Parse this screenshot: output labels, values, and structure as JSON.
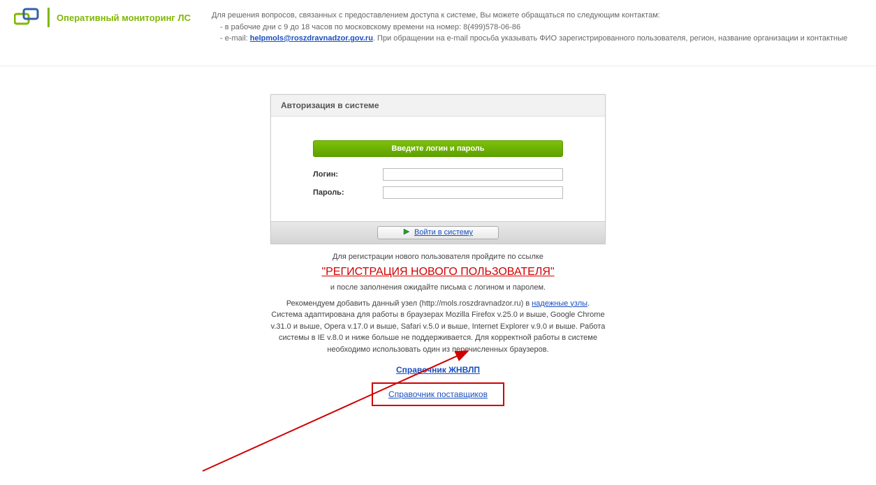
{
  "header": {
    "app_title": "Оперативный мониторинг ЛС",
    "contact_intro": "Для решения вопросов, связанных с предоставлением доступа к системе, Вы можете обращаться по следующим контактам:",
    "contact_phone": "- в рабочие дни с 9 до 18 часов по московскому времени на номер: 8(499)578-06-86",
    "contact_email_prefix": "- e-mail: ",
    "contact_email": "helpmols@roszdravnadzor.gov.ru",
    "contact_email_suffix": ". При обращении на e-mail просьба указывать ФИО зарегистрированного пользователя, регион, название организации и контактные"
  },
  "panel": {
    "title": "Авторизация в системе",
    "prompt": "Введите логин и пароль",
    "login_label": "Логин:",
    "password_label": "Пароль:",
    "login_button": "Войти в систему"
  },
  "info": {
    "reg_intro": "Для регистрации нового пользователя пройдите по ссылке",
    "reg_link": "\"РЕГИСТРАЦИЯ НОВОГО ПОЛЬЗОВАТЕЛЯ\"",
    "reg_outro": "и после заполнения ожидайте письма с логином и паролем.",
    "recommend_pre": "Рекомендуем добавить данный узел (http://mols.roszdravnadzor.ru) в ",
    "trusted_link": "надежные узлы",
    "recommend_post": ".",
    "browsers": "Система адаптирована для работы в браузерах Mozilla Firefox v.25.0 и выше, Google Chrome v.31.0 и выше, Opera v.17.0 и выше, Safari v.5.0 и выше, Internet Explorer v.9.0 и выше. Работа системы в IE v.8.0 и ниже больше не поддерживается. Для корректной работы в системе необходимо использовать один из перечисленных браузеров.",
    "ref_zhnvlp": "Справочник ЖНВЛП",
    "ref_suppliers": "Справочник поставщиков"
  }
}
